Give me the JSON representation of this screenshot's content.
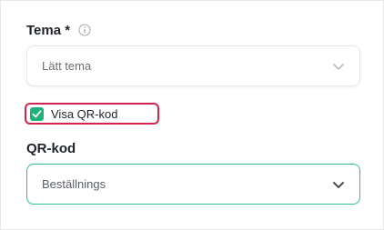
{
  "theme_field": {
    "label": "Tema *",
    "info_icon": "info-icon",
    "selected_value": "Lätt tema",
    "chevron_icon": "chevron-down-icon"
  },
  "qr_toggle": {
    "label": "Visa QR-kod",
    "checked": true,
    "check_color": "#1fb27c",
    "highlight_color": "#d1254f"
  },
  "qr_field": {
    "label": "QR-kod",
    "selected_value": "Beställnings",
    "chevron_icon": "chevron-down-icon",
    "border_color": "#2fbf8a"
  }
}
